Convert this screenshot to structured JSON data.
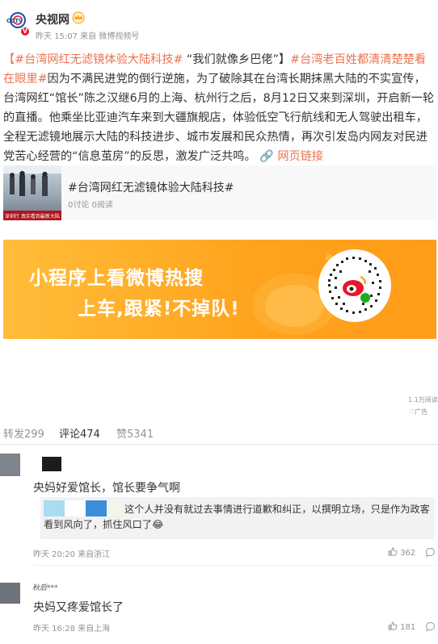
{
  "header": {
    "author": "央视网",
    "logo_text": "CCTV",
    "vbadge": "V",
    "meta": "昨天 15:07 来自 微博视频号"
  },
  "post": {
    "topic1": "【#台湾网红无滤镜体验大陆科技#",
    "quote": " “我们就像乡巴佬”】",
    "topic2": "#台湾老百姓都清清楚楚看在眼里#",
    "body": "因为不满民进党的倒行逆施，为了破除其在台湾长期抹黑大陆的不实宣传，台湾网红“馆长”陈之汉继6月的上海、杭州行之后，8月12日又来到深圳，开启新一轮的直播。他乘坐比亚迪汽车来到大疆旗舰店，体验低空飞行航线和无人驾驶出租车，全程无滤镜地展示大陆的科技进步、城市发展和民众热情，再次引发岛内网友对民进党苦心经营的“信息茧房”的反思，激发广泛共鸣。",
    "link_icon": "🔗",
    "link_text": "网页链接"
  },
  "card": {
    "title": "#台湾网红无滤镜体验大陆科技#",
    "stats": "0讨论 0阅读",
    "img_caption": "深圳行 真实看到最新大陆"
  },
  "banner": {
    "line1": "小程序上看微博热搜",
    "line2": "上车,跟紧!不掉队!",
    "bg_color": "#ffa21c"
  },
  "ad": {
    "meta": "1.1万阅读",
    "tag": "♡广告"
  },
  "tabs": {
    "forward": "转发299",
    "comment": "评论474",
    "like": "赞5341"
  },
  "comments": [
    {
      "text": "央妈好爱馆长，馆长要争气啊",
      "reply": "这个人并没有就过去事情进行道歉和纠正，以撰明立场，只是作为政客看到风向了，抓住风口了",
      "reply_emoji": "😂",
      "meta": "昨天 20:20 来自浙江",
      "likes": "362"
    },
    {
      "name": "秋后***",
      "text": "央妈又疼爱馆长了",
      "meta": "昨天 16:28 来自上海",
      "likes": "181"
    }
  ],
  "colors": {
    "accent": "#eb7350",
    "gray_text": "#939393"
  }
}
